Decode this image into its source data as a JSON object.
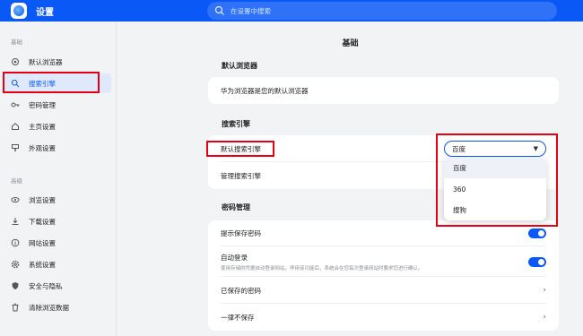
{
  "app": {
    "title": "设置"
  },
  "search": {
    "placeholder": "在设置中搜索"
  },
  "sidebar": {
    "sections": [
      {
        "title": "基础",
        "items": [
          {
            "label": "默认浏览器",
            "icon": "target-icon"
          },
          {
            "label": "搜索引擎",
            "icon": "search-icon",
            "active": true
          },
          {
            "label": "密码管理",
            "icon": "key-icon"
          },
          {
            "label": "主页设置",
            "icon": "home-icon"
          },
          {
            "label": "外观设置",
            "icon": "appearance-icon"
          }
        ]
      },
      {
        "title": "高级",
        "items": [
          {
            "label": "浏览设置",
            "icon": "eye-icon"
          },
          {
            "label": "下载设置",
            "icon": "download-icon"
          },
          {
            "label": "网站设置",
            "icon": "info-icon"
          },
          {
            "label": "系统设置",
            "icon": "gear-icon"
          },
          {
            "label": "安全与隐私",
            "icon": "shield-icon"
          },
          {
            "label": "清除浏览数据",
            "icon": "trash-icon"
          }
        ]
      }
    ]
  },
  "main": {
    "page_title": "基础",
    "default_browser": {
      "title": "默认浏览器",
      "status": "华为浏览器是您的默认浏览器"
    },
    "search_engine": {
      "title": "搜索引擎",
      "default_label": "默认搜索引擎",
      "manage_label": "管理搜索引擎",
      "selected": "百度",
      "options": [
        "百度",
        "360",
        "搜狗"
      ]
    },
    "password": {
      "title": "密码管理",
      "prompt_save": "提示保存密码",
      "auto_login": "自动登录",
      "auto_login_desc": "使用存储的凭据自动登录网站。停用该功能后，系统会在您每次登录网站时要求您进行确认。",
      "saved": "已保存的密码",
      "never_save": "一律不保存"
    }
  },
  "colors": {
    "accent": "#0a59f7",
    "highlight": "#e60012"
  }
}
